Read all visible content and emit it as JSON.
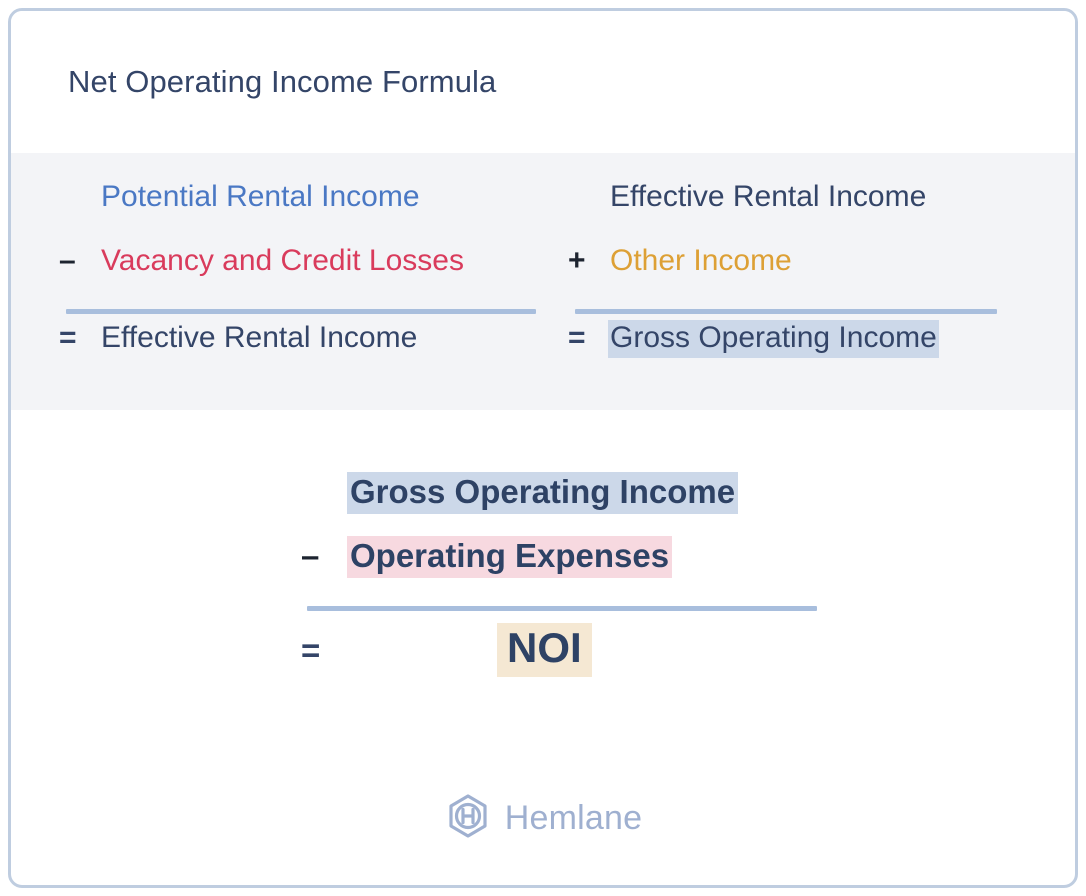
{
  "header": {
    "title": "Net Operating Income Formula"
  },
  "formulas": {
    "effective_rental_income": {
      "name": "effective-rental-income-formula",
      "rows": [
        {
          "operator": "",
          "term": "Potential Rental Income",
          "color": "blue",
          "highlight": "none"
        },
        {
          "operator": "–",
          "term": "Vacancy and Credit Losses",
          "color": "crimson",
          "highlight": "none"
        },
        {
          "operator": "=",
          "term": "Effective Rental Income",
          "color": "navy",
          "highlight": "none"
        }
      ]
    },
    "gross_operating_income": {
      "name": "gross-operating-income-formula",
      "rows": [
        {
          "operator": "",
          "term": "Effective Rental Income",
          "color": "navy",
          "highlight": "none"
        },
        {
          "operator": "+",
          "term": "Other Income",
          "color": "amber",
          "highlight": "none"
        },
        {
          "operator": "=",
          "term": "Gross Operating Income",
          "color": "navy",
          "highlight": "blue"
        }
      ]
    },
    "noi": {
      "name": "noi-formula",
      "rows": [
        {
          "operator": "",
          "term": "Gross Operating Income",
          "highlight": "blue"
        },
        {
          "operator": "–",
          "term": "Operating Expenses",
          "highlight": "pink"
        },
        {
          "operator": "=",
          "term": "NOI",
          "highlight": "cream"
        }
      ]
    }
  },
  "footer": {
    "brand": "Hemlane",
    "logo_icon": "hemlane-hexagon-h-logo"
  },
  "colors": {
    "title": "#344568",
    "navy": "#344568",
    "blue": "#4a78c4",
    "crimson": "#d93b5c",
    "amber": "#dda035",
    "rule": "#a8bedd",
    "band_bg": "#f3f4f7",
    "card_border": "#bfcde0",
    "highlight_blue": "#ccd8e9",
    "highlight_pink": "#f7d9e0",
    "highlight_cream": "#f5e8d3",
    "logo": "#9fb0d0"
  }
}
